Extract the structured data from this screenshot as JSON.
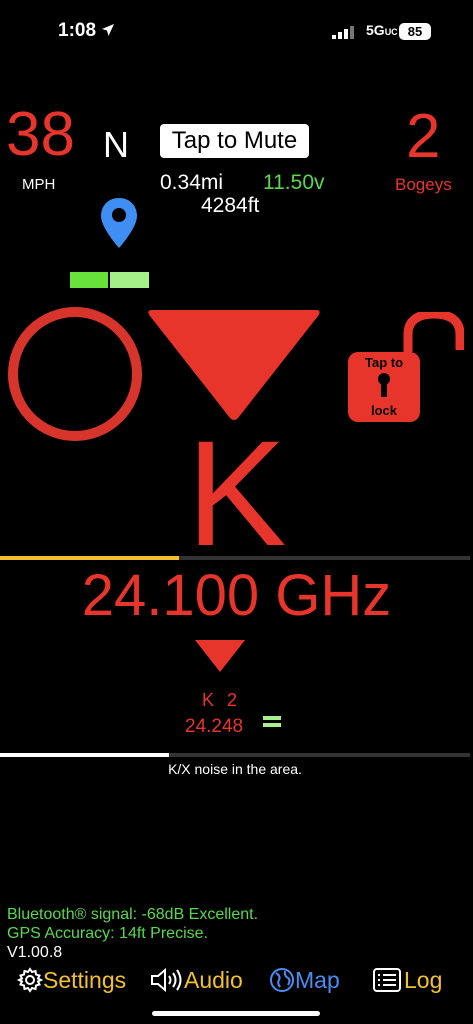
{
  "status": {
    "time": "1:08",
    "network": "5G",
    "network_sub": "UC",
    "battery": "85"
  },
  "top": {
    "speed": "38",
    "speed_unit": "MPH",
    "heading": "N",
    "mute_label": "Tap to Mute",
    "distance": "0.34mi",
    "voltage": "11.50v",
    "altitude": "4284ft",
    "bogeys_count": "2",
    "bogeys_label": "Bogeys"
  },
  "lock": {
    "line1": "Tap to",
    "line2": "lock"
  },
  "alert": {
    "band": "K",
    "frequency": "24.100 GHz",
    "signal_progress": 0.38,
    "sub_band": "K  2",
    "sub_frequency": "24.248",
    "sub_symbol": "=",
    "noise_progress": 0.36,
    "noise_text": "K/X noise in the area."
  },
  "footer": {
    "bluetooth": "Bluetooth® signal: -68dB Excellent.",
    "gps": "GPS Accuracy: 14ft Precise.",
    "version": "V1.00.8"
  },
  "nav": {
    "settings": "Settings",
    "audio": "Audio",
    "map": "Map",
    "log": "Log"
  },
  "colors": {
    "alert_red": "#e8352c",
    "accent_yellow": "#f2c12c",
    "green": "#5ad84b",
    "map_blue": "#4a8df0"
  },
  "icons": [
    "location-arrow-icon",
    "location-pin-icon",
    "gear-icon",
    "speaker-icon",
    "globe-icon",
    "list-icon"
  ]
}
